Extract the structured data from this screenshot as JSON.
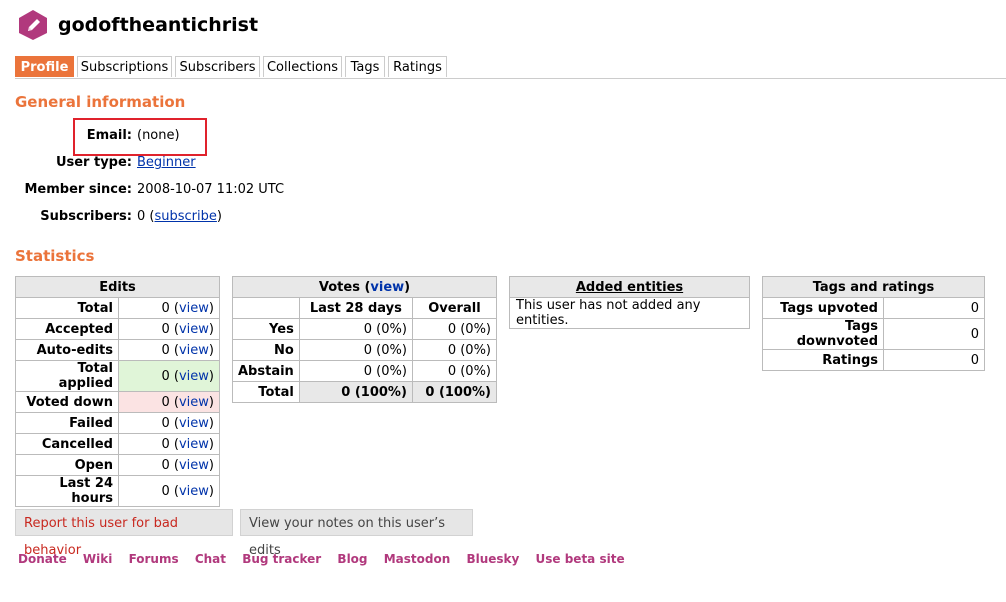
{
  "user": {
    "name": "godoftheantichrist",
    "icon": "pencil-hexagon-icon",
    "icon_color": "#b1397d"
  },
  "tabs": [
    "Profile",
    "Subscriptions",
    "Subscribers",
    "Collections",
    "Tags",
    "Ratings"
  ],
  "general": {
    "heading": "General information",
    "email_label": "Email:",
    "email_value": "(none)",
    "user_type_label": "User type:",
    "user_type_value": "Beginner",
    "member_since_label": "Member since:",
    "member_since_value": "2008-10-07 11:02 UTC",
    "subscribers_label": "Subscribers:",
    "subscribers_count": "0",
    "subscribe_link": "subscribe"
  },
  "statistics": {
    "heading": "Statistics",
    "edits": {
      "title": "Edits",
      "view_label": "view",
      "rows": [
        {
          "label": "Total",
          "value": "0"
        },
        {
          "label": "Accepted",
          "value": "0"
        },
        {
          "label": "Auto-edits",
          "value": "0"
        },
        {
          "label": "Total applied",
          "value": "0"
        },
        {
          "label": "Voted down",
          "value": "0"
        },
        {
          "label": "Failed",
          "value": "0"
        },
        {
          "label": "Cancelled",
          "value": "0"
        },
        {
          "label": "Open",
          "value": "0"
        },
        {
          "label": "Last 24 hours",
          "value": "0"
        }
      ]
    },
    "votes": {
      "title": "Votes",
      "view_label": "view",
      "col1": "Last 28 days",
      "col2": "Overall",
      "rows": [
        {
          "label": "Yes",
          "last28": "0 (0%)",
          "overall": "0 (0%)"
        },
        {
          "label": "No",
          "last28": "0 (0%)",
          "overall": "0 (0%)"
        },
        {
          "label": "Abstain",
          "last28": "0 (0%)",
          "overall": "0 (0%)"
        },
        {
          "label": "Total",
          "last28": "0 (100%)",
          "overall": "0 (100%)"
        }
      ]
    },
    "added": {
      "title": "Added entities",
      "message": "This user has not added any entities."
    },
    "tags": {
      "title": "Tags and ratings",
      "rows": [
        {
          "label": "Tags upvoted",
          "value": "0"
        },
        {
          "label": "Tags downvoted",
          "value": "0"
        },
        {
          "label": "Ratings",
          "value": "0"
        }
      ]
    }
  },
  "buttons": {
    "report": "Report this user for bad behavior",
    "notes": "View your notes on this user’s edits"
  },
  "footer": [
    "Donate",
    "Wiki",
    "Forums",
    "Chat",
    "Bug tracker",
    "Blog",
    "Mastodon",
    "Bluesky",
    "Use beta site"
  ],
  "colors": {
    "accent": "#eb743b",
    "highlight": "#e0222c",
    "link": "#0033aa",
    "footer_link": "#b1397d"
  }
}
